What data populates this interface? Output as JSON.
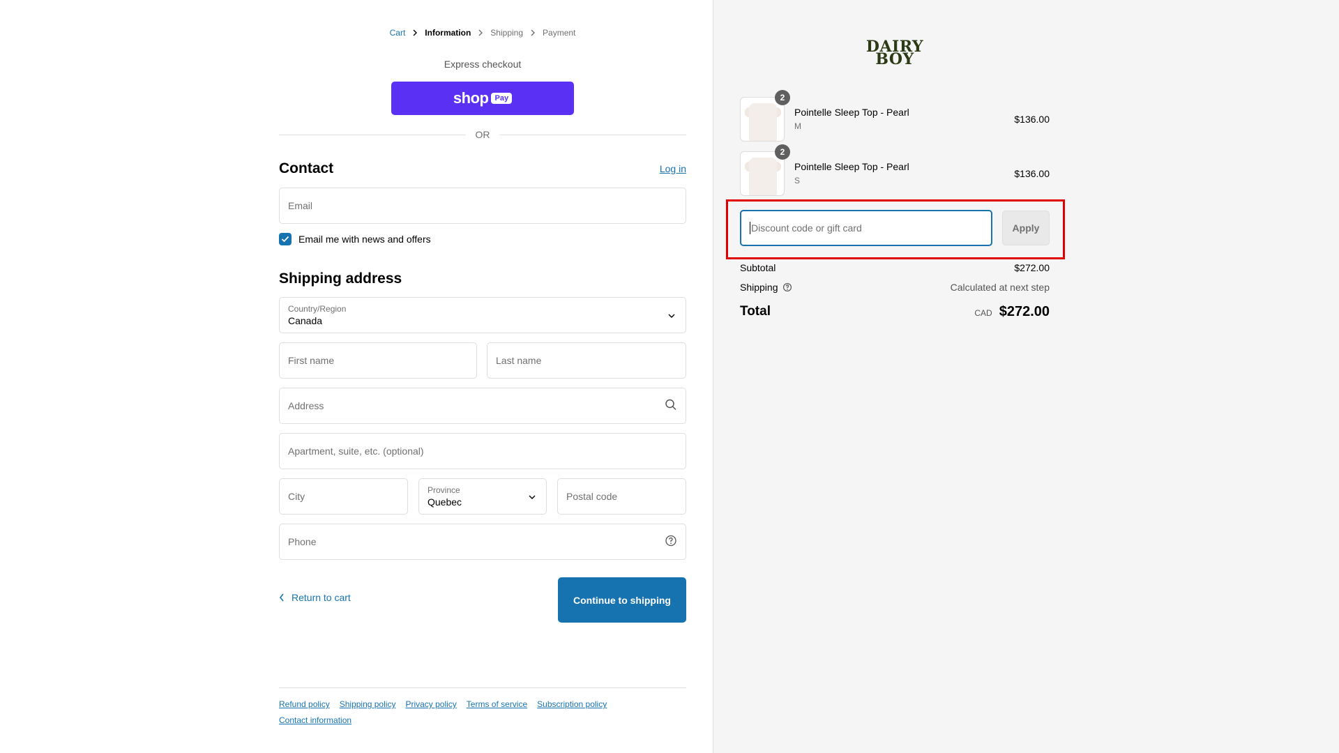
{
  "breadcrumbs": {
    "cart": "Cart",
    "information": "Information",
    "shipping": "Shipping",
    "payment": "Payment"
  },
  "express": {
    "label": "Express checkout",
    "shoppay_brand": "shop",
    "shoppay_pay": "Pay",
    "divider": "OR"
  },
  "contact": {
    "title": "Contact",
    "login": "Log in",
    "email_placeholder": "Email",
    "newsletter_label": "Email me with news and offers",
    "newsletter_checked": true
  },
  "shipping_address": {
    "title": "Shipping address",
    "country_label": "Country/Region",
    "country_value": "Canada",
    "first_name_placeholder": "First name",
    "last_name_placeholder": "Last name",
    "address_placeholder": "Address",
    "apartment_placeholder": "Apartment, suite, etc. (optional)",
    "city_placeholder": "City",
    "province_label": "Province",
    "province_value": "Quebec",
    "postal_placeholder": "Postal code",
    "phone_placeholder": "Phone"
  },
  "actions": {
    "return_label": "Return to cart",
    "continue_label": "Continue to shipping"
  },
  "footer": {
    "links": [
      "Refund policy",
      "Shipping policy",
      "Privacy policy",
      "Terms of service",
      "Subscription policy",
      "Contact information"
    ]
  },
  "summary": {
    "logo_line1": "DAIRY",
    "logo_line2": "BOY",
    "items": [
      {
        "qty": "2",
        "name": "Pointelle Sleep Top - Pearl",
        "variant": "M",
        "price": "$136.00"
      },
      {
        "qty": "2",
        "name": "Pointelle Sleep Top - Pearl",
        "variant": "S",
        "price": "$136.00"
      }
    ],
    "discount_placeholder": "Discount code or gift card",
    "apply_label": "Apply",
    "subtotal_label": "Subtotal",
    "subtotal_value": "$272.00",
    "shipping_label": "Shipping",
    "shipping_value": "Calculated at next step",
    "total_label": "Total",
    "currency": "CAD",
    "total_value": "$272.00"
  },
  "colors": {
    "accent": "#1773b0",
    "shoppay": "#5a31f4",
    "highlight": "#e00000"
  }
}
